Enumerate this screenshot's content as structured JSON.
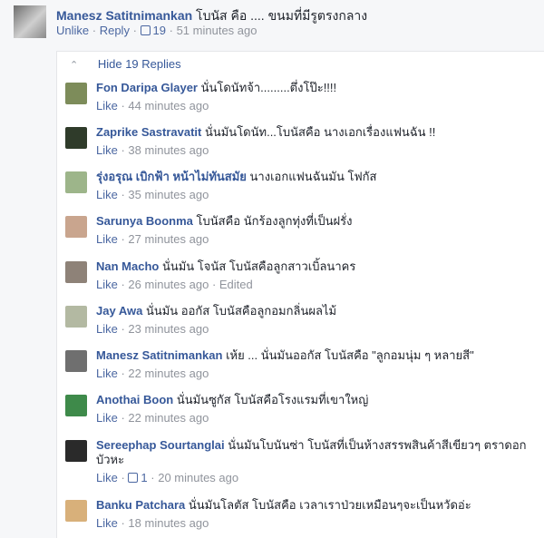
{
  "top_comment": {
    "author": "Manesz Satitnimankan",
    "text": "โบนัส คือ .... ขนมที่มีรูตรงกลาง",
    "unlike": "Unlike",
    "reply": "Reply",
    "likes": "19",
    "time": "51 minutes ago"
  },
  "toggle": {
    "label": "Hide 19 Replies",
    "icon": "chevron-up-icon"
  },
  "replies": [
    {
      "author": "Fon Daripa Glayer",
      "text": "นั่นโดนัทจ้า.........ตึ่งโป๊ะ!!!!",
      "like": "Like",
      "time": "44 minutes ago",
      "color": "#7d8c5a"
    },
    {
      "author": "Zaprike Sastravatit",
      "text": "นั่นมันโดนัท...โบนัสคือ นางเอกเรื่องแฟนฉัน !!",
      "like": "Like",
      "time": "38 minutes ago",
      "color": "#2f3b2a"
    },
    {
      "author": "รุ่งอรุณ เบิกฟ้า หน้าไม่ทันสมัย",
      "text": "นางเอกแฟนฉันมัน โฟกัส",
      "like": "Like",
      "time": "35 minutes ago",
      "color": "#9db58a"
    },
    {
      "author": "Sarunya Boonma",
      "text": "โบนัสคือ นักร้องลูกทุ่งที่เป็นฝรั่ง",
      "like": "Like",
      "time": "27 minutes ago",
      "color": "#c9a58e"
    },
    {
      "author": "Nan Macho",
      "text": "นั่นมัน โจนัส โบนัสคือลูกสาวเบิ้ลนาคร",
      "like": "Like",
      "time": "26 minutes ago",
      "edited": "Edited",
      "color": "#8e8278"
    },
    {
      "author": "Jay Awa",
      "text": "นั่นมัน ออกัส โบนัสคือลูกอมกลิ่นผลไม้",
      "like": "Like",
      "time": "23 minutes ago",
      "color": "#b3b9a2"
    },
    {
      "author": "Manesz Satitnimankan",
      "text": "เห้ย ... นั่นมันออกัส โบนัสคือ \"ลูกอมนุ่ม ๆ หลายสี\"",
      "like": "Like",
      "time": "22 minutes ago",
      "color": "#6f6f6f"
    },
    {
      "author": "Anothai Boon",
      "text": "นั่นมันซูกัส โบนัสคือโรงแรมที่เขาใหญ่",
      "like": "Like",
      "time": "22 minutes ago",
      "color": "#3e8a4a"
    },
    {
      "author": "Sereephap Sourtanglai",
      "text": "นั่นมันโบนันซ่า โบนัสที่เป็นห้างสรรพสินค้าสีเขียวๆ ตราดอกบัวหะ",
      "like": "Like",
      "likes": "1",
      "time": "20 minutes ago",
      "color": "#2a2a2a"
    },
    {
      "author": "Banku Patchara",
      "text": "นั่นมันโลตัส โบนัสคือ เวลาเราป่วยเหมือนๆจะเป็นหวัดอ่ะ",
      "like": "Like",
      "time": "18 minutes ago",
      "color": "#d8b07a"
    }
  ]
}
